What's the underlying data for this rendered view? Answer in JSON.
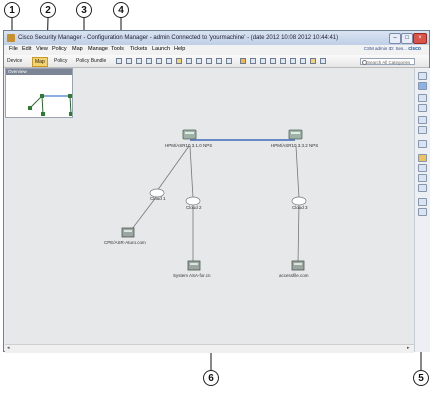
{
  "callouts": [
    "1",
    "2",
    "3",
    "4",
    "5",
    "6"
  ],
  "window": {
    "title": "Cisco Security Manager - Configuration Manager - admin Connected to 'yourmachine' - (date 2012 10:08 2012 10:44:41)",
    "minimize": "–",
    "maximize": "□",
    "close": "×"
  },
  "menu": [
    "File",
    "Edit",
    "View",
    "Policy",
    "Map",
    "Manage",
    "Tools",
    "Tickets",
    "Launch",
    "Help"
  ],
  "toolbar": {
    "device": "Device",
    "map": "Map",
    "policy": "Policy",
    "policy_bundle": "Policy Bundle"
  },
  "header": {
    "user": "CSM admin  ID: Ses...",
    "brand": "cisco",
    "search_placeholder": "Search All Categories"
  },
  "overview": {
    "title": "Overview"
  },
  "map": {
    "nodes": [
      {
        "label": "HPM/ASR10 3.1.0 NPS"
      },
      {
        "label": "HPM/ASR10 3.3.2 NPS"
      },
      {
        "label": "Cloud 1"
      },
      {
        "label": "Cloud 2"
      },
      {
        "label": "Cloud 3"
      },
      {
        "label": "CPE/ASR-Aturo.com"
      },
      {
        "label": "System ASA-for.cn"
      },
      {
        "label": "accessfile.com"
      }
    ]
  },
  "icons": {
    "app": "csm-app-icon",
    "search": "search-icon",
    "router": "router-icon",
    "cloud": "cloud-icon",
    "server": "server-icon"
  }
}
